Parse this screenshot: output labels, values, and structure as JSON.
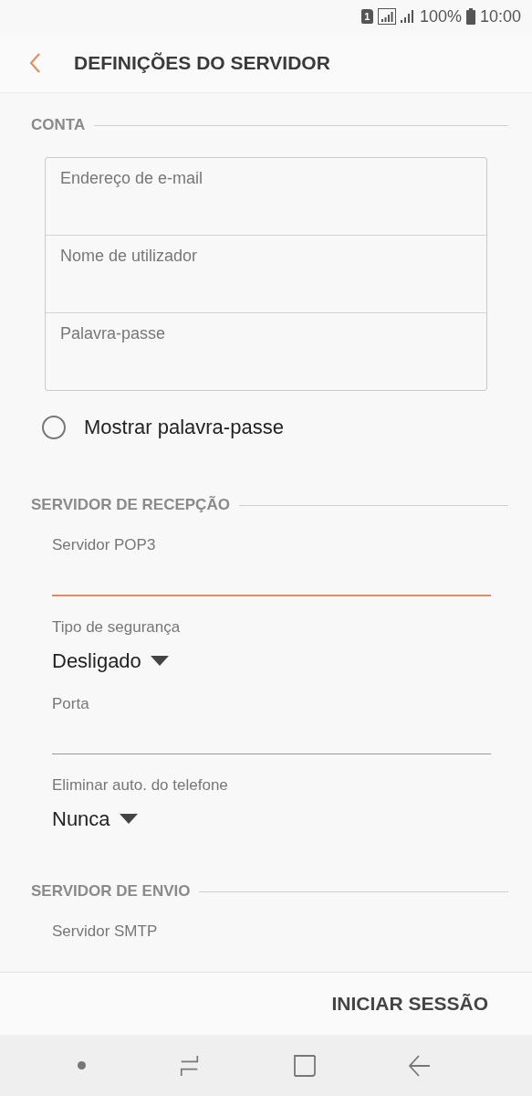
{
  "status_bar": {
    "sim": "1",
    "battery": "100%",
    "time": "10:00"
  },
  "header": {
    "title": "DEFINIÇÕES DO SERVIDOR"
  },
  "account": {
    "heading": "CONTA",
    "fields": [
      {
        "placeholder": "Endereço de e-mail"
      },
      {
        "placeholder": "Nome de utilizador"
      },
      {
        "placeholder": "Palavra-passe"
      }
    ],
    "show_password": {
      "label": "Mostrar palavra-passe",
      "checked": false
    }
  },
  "incoming": {
    "heading": "SERVIDOR DE RECEPÇÃO",
    "items": [
      {
        "kind": "text",
        "label": "Servidor POP3",
        "focused": true
      },
      {
        "kind": "select",
        "label": "Tipo de segurança",
        "value": "Desligado"
      },
      {
        "kind": "text",
        "label": "Porta",
        "focused": false
      },
      {
        "kind": "select",
        "label": "Eliminar auto. do telefone",
        "value": "Nunca"
      }
    ]
  },
  "outgoing": {
    "heading": "SERVIDOR DE ENVIO",
    "items": [
      {
        "label": "Servidor SMTP"
      }
    ]
  },
  "footer": {
    "button": "INICIAR SESSÃO"
  }
}
